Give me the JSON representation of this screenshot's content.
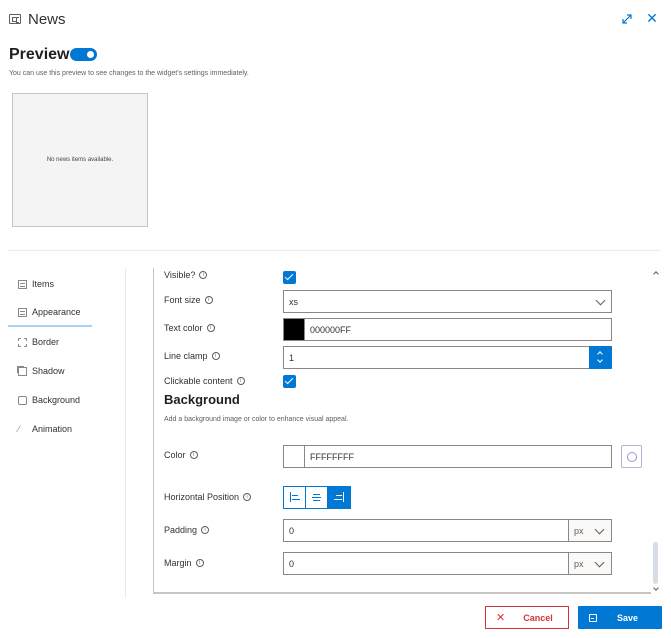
{
  "window": {
    "title": "News",
    "icon": "news-widget-icon",
    "expand_icon": "expand-icon",
    "close_icon": "close-icon",
    "close_glyph": "✕"
  },
  "preview": {
    "heading": "Preview",
    "toggle_on": true,
    "description": "You can use this preview to see changes to the widget's settings immediately.",
    "empty_text": "No news items available."
  },
  "sidebar": {
    "items": [
      {
        "label": "Items",
        "icon": "panel-icon"
      },
      {
        "label": "Appearance",
        "icon": "panel-icon",
        "active": true
      },
      {
        "label": "Border",
        "icon": "border-icon"
      },
      {
        "label": "Shadow",
        "icon": "shadow-icon"
      },
      {
        "label": "Background",
        "icon": "background-icon"
      },
      {
        "label": "Animation",
        "icon": "magic-wand-icon",
        "glyph": "⁄"
      }
    ]
  },
  "appearance": {
    "visible": {
      "label": "Visible?",
      "checked": true
    },
    "font_size": {
      "label": "Font size",
      "value": "xs"
    },
    "text_color": {
      "label": "Text color",
      "value": "000000FF",
      "swatch": "#000000"
    },
    "line_clamp": {
      "label": "Line clamp",
      "value": "1"
    },
    "clickable_content": {
      "label": "Clickable content",
      "checked": true
    }
  },
  "background": {
    "title": "Background",
    "description": "Add a background image or color to enhance visual appeal.",
    "color": {
      "label": "Color",
      "value": "FFFFFFFF",
      "swatch": "#FFFFFF"
    },
    "horizontal_position": {
      "label": "Horizontal Position",
      "options": [
        "left",
        "center",
        "right"
      ],
      "selected": "right"
    },
    "padding": {
      "label": "Padding",
      "value": "0",
      "unit": "px"
    },
    "margin": {
      "label": "Margin",
      "value": "0",
      "unit": "px"
    }
  },
  "info_glyph": "i",
  "footer": {
    "cancel_label": "Cancel",
    "cancel_glyph": "✕",
    "save_label": "Save"
  },
  "colors": {
    "accent": "#0078d4",
    "danger": "#d13438"
  }
}
